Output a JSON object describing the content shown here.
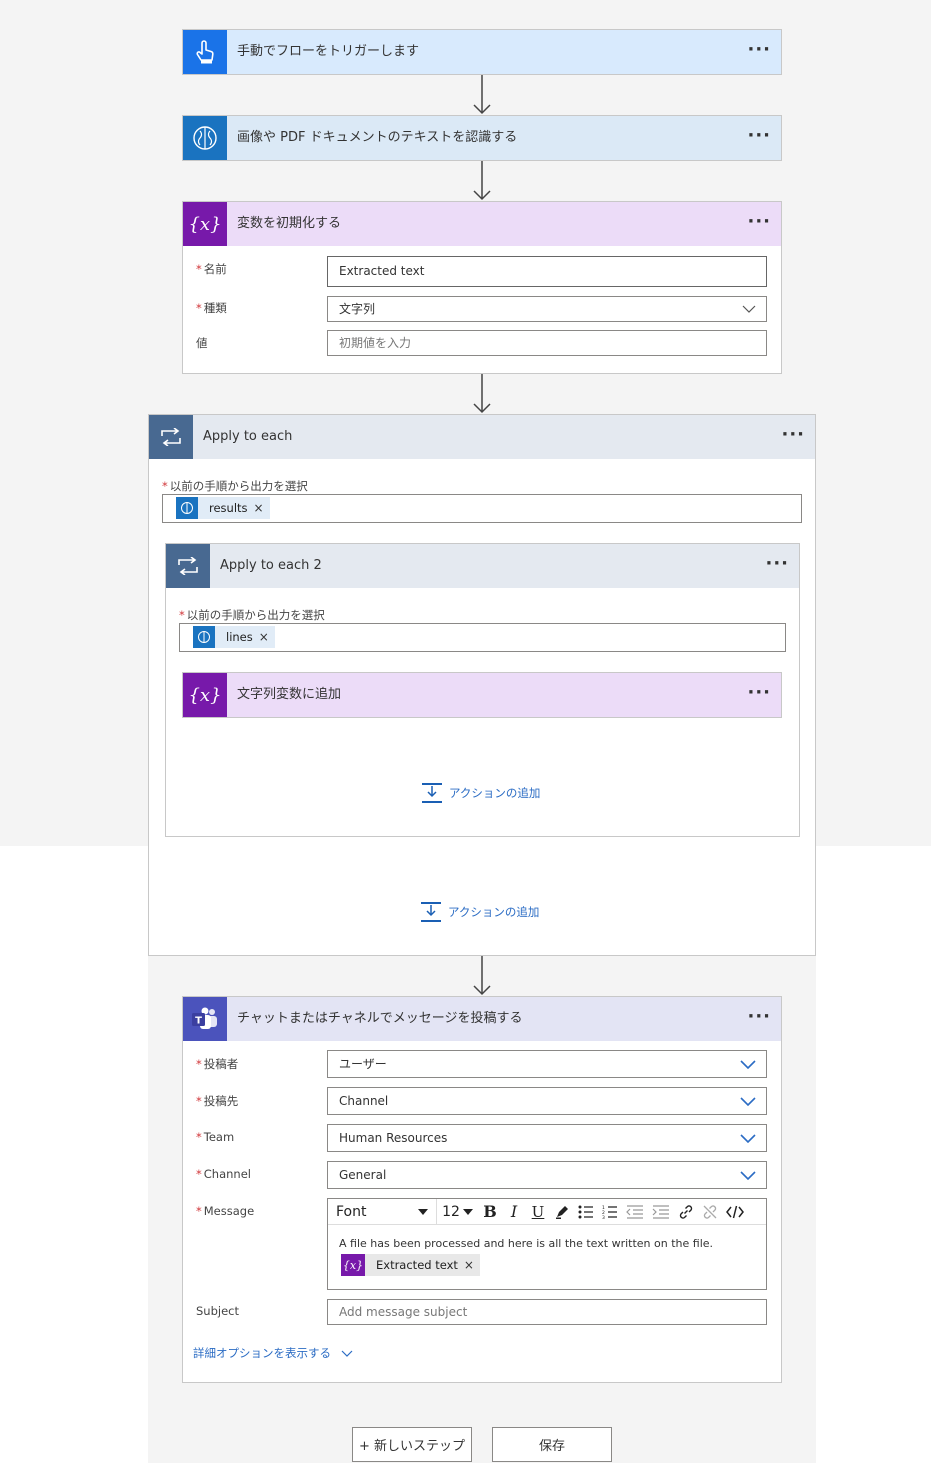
{
  "colors": {
    "trigger_header": "#d8eafd",
    "trigger_icon": "#1a73e8",
    "ai_header": "#dbe9f6",
    "ai_icon": "#1a73c0",
    "variable_header": "#ecdcf8",
    "variable_icon": "#7719aa",
    "loop_header": "#e4e9f0",
    "loop_icon": "#486991",
    "teams_header": "#e3e4f4",
    "teams_icon": "#4b53bc",
    "link": "#2b6cc4",
    "required": "#d13438"
  },
  "more_label": "···",
  "steps": {
    "trigger": {
      "title": "手動でフローをトリガーします",
      "icon": "hand-touch-icon"
    },
    "ocr": {
      "title": "画像や PDF ドキュメントのテキストを認識する",
      "icon": "ai-brain-icon"
    },
    "init_var": {
      "title": "変数を初期化する",
      "icon": "variable-icon",
      "name_label": "名前",
      "name_value": "Extracted text",
      "type_label": "種類",
      "type_value": "文字列",
      "value_label": "値",
      "value_placeholder": "初期値を入力"
    },
    "apply_each": {
      "title": "Apply to each",
      "select_label": "以前の手順から出力を選択",
      "token": "results",
      "add_action": "アクションの追加"
    },
    "apply_each_2": {
      "title": "Apply to each 2",
      "select_label": "以前の手順から出力を選択",
      "token": "lines",
      "add_action": "アクションの追加"
    },
    "append_var": {
      "title": "文字列変数に追加"
    },
    "teams": {
      "title": "チャットまたはチャネルでメッセージを投稿する",
      "poster_label": "投稿者",
      "poster_value": "ユーザー",
      "post_in_label": "投稿先",
      "post_in_value": "Channel",
      "team_label": "Team",
      "team_value": "Human Resources",
      "channel_label": "Channel",
      "channel_value": "General",
      "message_label": "Message",
      "font_label": "Font",
      "font_size": "12",
      "message_text": "A file has been processed and here is all the text written on the file.",
      "message_token": "Extracted text",
      "subject_label": "Subject",
      "subject_placeholder": "Add message subject",
      "advanced_link": "詳細オプションを表示する"
    }
  },
  "footer": {
    "new_step": "+ 新しいステップ",
    "save": "保存"
  }
}
